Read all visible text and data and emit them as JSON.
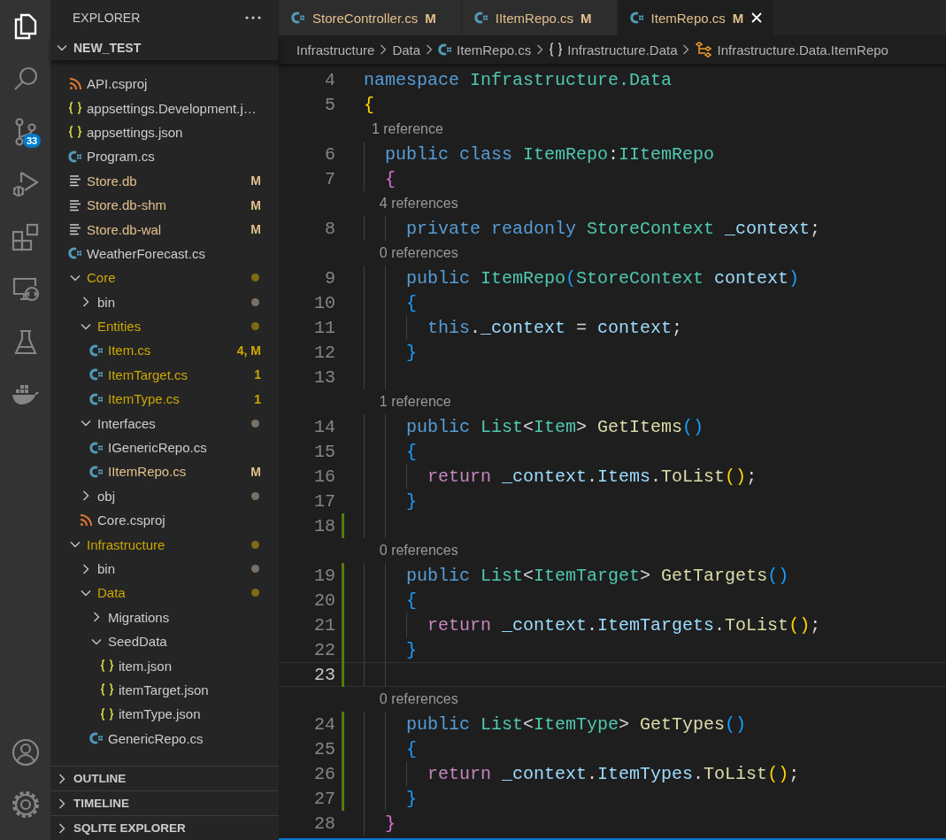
{
  "activity_bar": {
    "top": [
      {
        "kind": "explorer",
        "selected": true
      },
      {
        "kind": "search",
        "selected": false
      },
      {
        "kind": "source-control",
        "selected": false,
        "badge": "33"
      },
      {
        "kind": "run-debug",
        "selected": false
      },
      {
        "kind": "extensions",
        "selected": false
      },
      {
        "kind": "remote",
        "selected": false
      },
      {
        "kind": "testing",
        "selected": false
      },
      {
        "kind": "docker",
        "selected": false
      }
    ],
    "bottom": [
      {
        "kind": "account",
        "selected": false
      },
      {
        "kind": "settings",
        "selected": false
      }
    ]
  },
  "sidebar": {
    "title": "EXPLORER",
    "root": {
      "label": "NEW_TEST",
      "expanded": true,
      "children": [
        {
          "kind": "project",
          "label": "API.csproj",
          "modified": false,
          "problems": false,
          "dot": false
        },
        {
          "kind": "json",
          "label": "appsettings.Development.j…",
          "modified": false,
          "problems": false,
          "dot": false
        },
        {
          "kind": "json",
          "label": "appsettings.json",
          "modified": false,
          "problems": false,
          "dot": false
        },
        {
          "kind": "csharp",
          "label": "Program.cs",
          "modified": false,
          "problems": false,
          "dot": false
        },
        {
          "kind": "text",
          "label": "Store.db",
          "modified": true,
          "problems": false,
          "dot": false,
          "badge": "M"
        },
        {
          "kind": "text",
          "label": "Store.db-shm",
          "modified": true,
          "problems": false,
          "dot": false,
          "badge": "M"
        },
        {
          "kind": "text",
          "label": "Store.db-wal",
          "modified": true,
          "problems": false,
          "dot": false,
          "badge": "M"
        },
        {
          "kind": "csharp",
          "label": "WeatherForecast.cs",
          "modified": false,
          "problems": false,
          "dot": false
        },
        {
          "kind": "folder",
          "label": "Core",
          "modified": false,
          "problems": true,
          "dot": true,
          "expanded": true,
          "children": [
            {
              "kind": "folder",
              "label": "bin",
              "modified": false,
              "problems": false,
              "dot": true,
              "expanded": false
            },
            {
              "kind": "folder",
              "label": "Entities",
              "modified": false,
              "problems": true,
              "dot": true,
              "expanded": true,
              "children": [
                {
                  "kind": "csharp",
                  "label": "Item.cs",
                  "modified": true,
                  "problems": true,
                  "dot": false,
                  "badge": "4, M"
                },
                {
                  "kind": "csharp",
                  "label": "ItemTarget.cs",
                  "modified": false,
                  "problems": true,
                  "dot": false,
                  "badge": "1"
                },
                {
                  "kind": "csharp",
                  "label": "ItemType.cs",
                  "modified": false,
                  "problems": true,
                  "dot": false,
                  "badge": "1"
                }
              ]
            },
            {
              "kind": "folder",
              "label": "Interfaces",
              "modified": false,
              "problems": false,
              "dot": true,
              "expanded": true,
              "children": [
                {
                  "kind": "csharp",
                  "label": "IGenericRepo.cs",
                  "modified": false,
                  "problems": false,
                  "dot": false
                },
                {
                  "kind": "csharp",
                  "label": "IItemRepo.cs",
                  "modified": true,
                  "problems": false,
                  "dot": false,
                  "badge": "M"
                }
              ]
            },
            {
              "kind": "folder",
              "label": "obj",
              "modified": false,
              "problems": false,
              "dot": true,
              "expanded": false
            },
            {
              "kind": "project",
              "label": "Core.csproj",
              "modified": false,
              "problems": false,
              "dot": false
            }
          ]
        },
        {
          "kind": "folder",
          "label": "Infrastructure",
          "modified": false,
          "problems": true,
          "dot": true,
          "expanded": true,
          "children": [
            {
              "kind": "folder",
              "label": "bin",
              "modified": false,
              "problems": false,
              "dot": true,
              "expanded": false
            },
            {
              "kind": "folder",
              "label": "Data",
              "modified": false,
              "problems": true,
              "dot": true,
              "expanded": true,
              "children": [
                {
                  "kind": "folder",
                  "label": "Migrations",
                  "modified": false,
                  "problems": false,
                  "dot": false,
                  "expanded": false
                },
                {
                  "kind": "folder",
                  "label": "SeedData",
                  "modified": false,
                  "problems": false,
                  "dot": false,
                  "expanded": true,
                  "children": [
                    {
                      "kind": "json",
                      "label": "item.json",
                      "modified": false,
                      "problems": false,
                      "dot": false
                    },
                    {
                      "kind": "json",
                      "label": "itemTarget.json",
                      "modified": false,
                      "problems": false,
                      "dot": false
                    },
                    {
                      "kind": "json",
                      "label": "itemType.json",
                      "modified": false,
                      "problems": false,
                      "dot": false
                    }
                  ]
                },
                {
                  "kind": "csharp",
                  "label": "GenericRepo.cs",
                  "modified": false,
                  "problems": false,
                  "dot": false
                }
              ]
            }
          ]
        }
      ]
    },
    "panels": [
      {
        "label": "OUTLINE",
        "expanded": false
      },
      {
        "label": "TIMELINE",
        "expanded": false
      },
      {
        "label": "SQLITE EXPLORER",
        "expanded": false
      }
    ]
  },
  "tabs": [
    {
      "label": "StoreController.cs",
      "badge": "M",
      "selected": false
    },
    {
      "label": "IItemRepo.cs",
      "badge": "M",
      "selected": false
    },
    {
      "label": "ItemRepo.cs",
      "badge": "M",
      "selected": true
    }
  ],
  "breadcrumb": [
    {
      "kind": "folder",
      "label": "Infrastructure"
    },
    {
      "kind": "folder",
      "label": "Data"
    },
    {
      "kind": "csharp",
      "label": "ItemRepo.cs"
    },
    {
      "kind": "namespace",
      "label": "Infrastructure.Data"
    },
    {
      "kind": "class",
      "label": "Infrastructure.Data.ItemRepo"
    }
  ],
  "code": [
    {
      "kind": "code",
      "number": "4",
      "modified": false,
      "current": false,
      "tokens": [
        {
          "kind": "kw",
          "t": "namespace "
        },
        {
          "kind": "type",
          "t": "Infrastructure.Data"
        }
      ]
    },
    {
      "kind": "code",
      "number": "5",
      "modified": false,
      "current": false,
      "tokens": [
        {
          "kind": "b1",
          "t": "{"
        }
      ]
    },
    {
      "kind": "lens",
      "text": "  1 reference"
    },
    {
      "kind": "code",
      "number": "6",
      "modified": false,
      "current": false,
      "tokens": [
        {
          "kind": "kw",
          "t": "  public class "
        },
        {
          "kind": "type",
          "t": "ItemRepo"
        },
        {
          "kind": "p",
          "t": ":"
        },
        {
          "kind": "type",
          "t": "IItemRepo"
        }
      ]
    },
    {
      "kind": "code",
      "number": "7",
      "modified": false,
      "current": false,
      "tokens": [
        {
          "kind": "b2",
          "t": "  {"
        }
      ]
    },
    {
      "kind": "lens",
      "text": "    4 references"
    },
    {
      "kind": "code",
      "number": "8",
      "modified": false,
      "current": false,
      "tokens": [
        {
          "kind": "kw",
          "t": "    private readonly "
        },
        {
          "kind": "type",
          "t": "StoreContext "
        },
        {
          "kind": "var",
          "t": "_context"
        },
        {
          "kind": "p",
          "t": ";"
        }
      ]
    },
    {
      "kind": "lens",
      "text": "    0 references"
    },
    {
      "kind": "code",
      "number": "9",
      "modified": false,
      "current": false,
      "tokens": [
        {
          "kind": "kw",
          "t": "    public "
        },
        {
          "kind": "type",
          "t": "ItemRepo"
        },
        {
          "kind": "b3",
          "t": "("
        },
        {
          "kind": "type",
          "t": "StoreContext "
        },
        {
          "kind": "var",
          "t": "context"
        },
        {
          "kind": "b3",
          "t": ")"
        }
      ]
    },
    {
      "kind": "code",
      "number": "10",
      "modified": false,
      "current": false,
      "tokens": [
        {
          "kind": "b3",
          "t": "    {"
        }
      ]
    },
    {
      "kind": "code",
      "number": "11",
      "modified": false,
      "current": false,
      "tokens": [
        {
          "kind": "kw",
          "t": "      this"
        },
        {
          "kind": "p",
          "t": "."
        },
        {
          "kind": "var",
          "t": "_context"
        },
        {
          "kind": "p",
          "t": " = "
        },
        {
          "kind": "var",
          "t": "context"
        },
        {
          "kind": "p",
          "t": ";"
        }
      ]
    },
    {
      "kind": "code",
      "number": "12",
      "modified": false,
      "current": false,
      "tokens": [
        {
          "kind": "b3",
          "t": "    }"
        }
      ]
    },
    {
      "kind": "code",
      "number": "13",
      "modified": false,
      "current": false
    },
    {
      "kind": "lens",
      "text": "    1 reference"
    },
    {
      "kind": "code",
      "number": "14",
      "modified": false,
      "current": false,
      "tokens": [
        {
          "kind": "kw",
          "t": "    public "
        },
        {
          "kind": "type",
          "t": "List"
        },
        {
          "kind": "p",
          "t": "<"
        },
        {
          "kind": "type",
          "t": "Item"
        },
        {
          "kind": "p",
          "t": "> "
        },
        {
          "kind": "fn",
          "t": "GetItems"
        },
        {
          "kind": "b3",
          "t": "()"
        }
      ]
    },
    {
      "kind": "code",
      "number": "15",
      "modified": false,
      "current": false,
      "tokens": [
        {
          "kind": "b3",
          "t": "    {"
        }
      ]
    },
    {
      "kind": "code",
      "number": "16",
      "modified": false,
      "current": false,
      "tokens": [
        {
          "kind": "ctl",
          "t": "      return "
        },
        {
          "kind": "var",
          "t": "_context"
        },
        {
          "kind": "p",
          "t": "."
        },
        {
          "kind": "var",
          "t": "Items"
        },
        {
          "kind": "p",
          "t": "."
        },
        {
          "kind": "fn",
          "t": "ToList"
        },
        {
          "kind": "b1",
          "t": "()"
        },
        {
          "kind": "p",
          "t": ";"
        }
      ]
    },
    {
      "kind": "code",
      "number": "17",
      "modified": false,
      "current": false,
      "tokens": [
        {
          "kind": "b3",
          "t": "    }"
        }
      ]
    },
    {
      "kind": "code",
      "number": "18",
      "modified": true,
      "current": false
    },
    {
      "kind": "lens",
      "text": "    0 references"
    },
    {
      "kind": "code",
      "number": "19",
      "modified": true,
      "current": false,
      "tokens": [
        {
          "kind": "kw",
          "t": "    public "
        },
        {
          "kind": "type",
          "t": "List"
        },
        {
          "kind": "p",
          "t": "<"
        },
        {
          "kind": "type",
          "t": "ItemTarget"
        },
        {
          "kind": "p",
          "t": "> "
        },
        {
          "kind": "fn",
          "t": "GetTargets"
        },
        {
          "kind": "b3",
          "t": "()"
        }
      ]
    },
    {
      "kind": "code",
      "number": "20",
      "modified": true,
      "current": false,
      "tokens": [
        {
          "kind": "b3",
          "t": "    {"
        }
      ]
    },
    {
      "kind": "code",
      "number": "21",
      "modified": true,
      "current": false,
      "tokens": [
        {
          "kind": "ctl",
          "t": "      return "
        },
        {
          "kind": "var",
          "t": "_context"
        },
        {
          "kind": "p",
          "t": "."
        },
        {
          "kind": "var",
          "t": "ItemTargets"
        },
        {
          "kind": "p",
          "t": "."
        },
        {
          "kind": "fn",
          "t": "ToList"
        },
        {
          "kind": "b1",
          "t": "()"
        },
        {
          "kind": "p",
          "t": ";"
        }
      ]
    },
    {
      "kind": "code",
      "number": "22",
      "modified": true,
      "current": false,
      "tokens": [
        {
          "kind": "b3",
          "t": "    }"
        }
      ]
    },
    {
      "kind": "code",
      "number": "23",
      "modified": true,
      "current": true
    },
    {
      "kind": "lens",
      "text": "    0 references"
    },
    {
      "kind": "code",
      "number": "24",
      "modified": true,
      "current": false,
      "tokens": [
        {
          "kind": "kw",
          "t": "    public "
        },
        {
          "kind": "type",
          "t": "List"
        },
        {
          "kind": "p",
          "t": "<"
        },
        {
          "kind": "type",
          "t": "ItemType"
        },
        {
          "kind": "p",
          "t": "> "
        },
        {
          "kind": "fn",
          "t": "GetTypes"
        },
        {
          "kind": "b3",
          "t": "()"
        }
      ]
    },
    {
      "kind": "code",
      "number": "25",
      "modified": true,
      "current": false,
      "tokens": [
        {
          "kind": "b3",
          "t": "    {"
        }
      ]
    },
    {
      "kind": "code",
      "number": "26",
      "modified": true,
      "current": false,
      "tokens": [
        {
          "kind": "ctl",
          "t": "      return "
        },
        {
          "kind": "var",
          "t": "_context"
        },
        {
          "kind": "p",
          "t": "."
        },
        {
          "kind": "var",
          "t": "ItemTypes"
        },
        {
          "kind": "p",
          "t": "."
        },
        {
          "kind": "fn",
          "t": "ToList"
        },
        {
          "kind": "b1",
          "t": "()"
        },
        {
          "kind": "p",
          "t": ";"
        }
      ]
    },
    {
      "kind": "code",
      "number": "27",
      "modified": true,
      "current": false,
      "tokens": [
        {
          "kind": "b3",
          "t": "    }"
        }
      ]
    },
    {
      "kind": "code",
      "number": "28",
      "modified": false,
      "current": false,
      "tokens": [
        {
          "kind": "b2",
          "t": "  }"
        }
      ]
    }
  ]
}
